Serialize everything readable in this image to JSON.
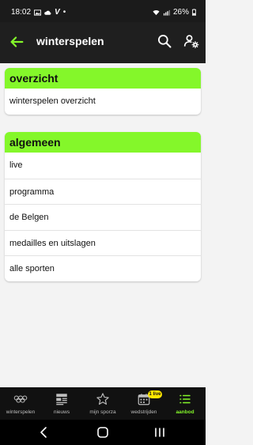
{
  "status_bar": {
    "time": "18:02",
    "extra": "V",
    "dot": "•",
    "battery": "26%"
  },
  "app_bar": {
    "title": "winterspelen"
  },
  "sections": [
    {
      "title": "overzicht",
      "items": [
        "winterspelen overzicht"
      ]
    },
    {
      "title": "algemeen",
      "items": [
        "live",
        "programma",
        "de Belgen",
        "medailles en uitslagen",
        "alle sporten"
      ]
    }
  ],
  "bottom_nav": {
    "items": [
      {
        "label": "winterspelen",
        "icon": "olympic-rings-icon"
      },
      {
        "label": "nieuws",
        "icon": "news-icon"
      },
      {
        "label": "mijn sporza",
        "icon": "star-icon"
      },
      {
        "label": "wedstrijden",
        "icon": "calendar-icon"
      },
      {
        "label": "aanbod",
        "icon": "list-icon"
      }
    ],
    "active": "aanbod",
    "badge": "1 live"
  },
  "colors": {
    "accent": "#84f72a",
    "badge": "#ffe600",
    "app_bar": "#1f1f1f"
  }
}
